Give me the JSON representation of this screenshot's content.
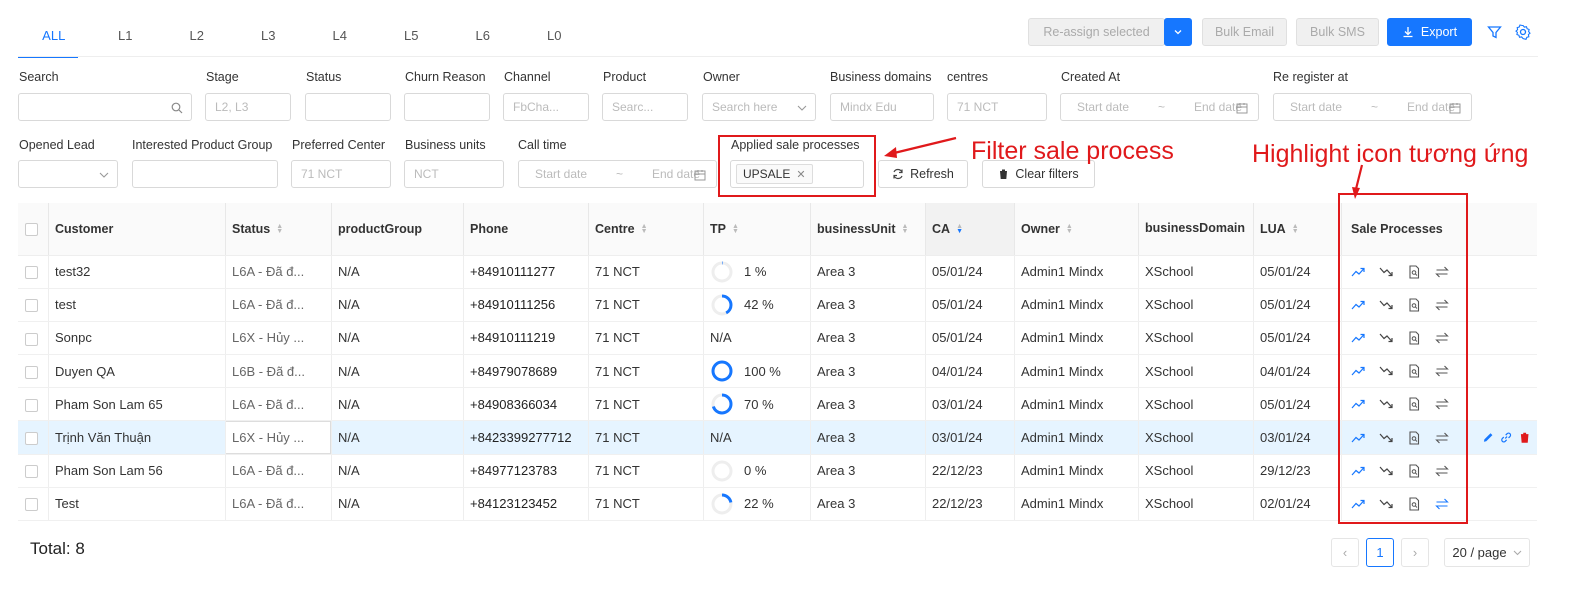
{
  "tabs": [
    "ALL",
    "L1",
    "L2",
    "L3",
    "L4",
    "L5",
    "L6",
    "L0"
  ],
  "toolbar": {
    "reassign": "Re-assign selected",
    "bulk_email": "Bulk Email",
    "bulk_sms": "Bulk SMS",
    "export": "Export"
  },
  "filters": {
    "search": "Search",
    "stage": "Stage",
    "stage_ph": "L2, L3",
    "status": "Status",
    "churn": "Churn Reason",
    "channel": "Channel",
    "channel_ph": "FbCha...",
    "product": "Product",
    "product_ph": "Searc...",
    "owner": "Owner",
    "owner_ph": "Search here",
    "bd": "Business domains",
    "bd_ph": "Mindx Edu",
    "centres": "centres",
    "centres_ph": "71 NCT",
    "created": "Created At",
    "reregister": "Re register at",
    "start": "Start date",
    "end": "End date",
    "opened": "Opened Lead",
    "ipg": "Interested Product Group",
    "pref": "Preferred Center",
    "pref_ph": "71 NCT",
    "bu": "Business units",
    "bu_ph": "NCT",
    "calltime": "Call time",
    "applied": "Applied sale processes",
    "applied_tag": "UPSALE",
    "refresh": "Refresh",
    "clear": "Clear filters"
  },
  "annotations": {
    "filter": "Filter sale process",
    "highlight": "Highlight icon tương ứng"
  },
  "columns": [
    "Customer",
    "Status",
    "productGroup",
    "Phone",
    "Centre",
    "TP",
    "businessUnit",
    "CA",
    "Owner",
    "businessDomain",
    "LUA",
    "Sale Processes"
  ],
  "rows": [
    {
      "customer": "test32",
      "status": "L6A - Đã đ...",
      "pg": "N/A",
      "phone": "+84910111277",
      "centre": "71 NCT",
      "tp": "1 %",
      "tpv": 1,
      "bu": "Area 3",
      "ca": "05/01/24",
      "owner": "Admin1 Mindx",
      "bd": "XSchool",
      "lua": "05/01/24"
    },
    {
      "customer": "test",
      "status": "L6A - Đã đ...",
      "pg": "N/A",
      "phone": "+84910111256",
      "centre": "71 NCT",
      "tp": "42 %",
      "tpv": 42,
      "bu": "Area 3",
      "ca": "05/01/24",
      "owner": "Admin1 Mindx",
      "bd": "XSchool",
      "lua": "05/01/24"
    },
    {
      "customer": "Sonpc",
      "status": "L6X - Hủy ...",
      "pg": "N/A",
      "phone": "+84910111219",
      "centre": "71 NCT",
      "tp": "N/A",
      "tpv": null,
      "bu": "Area 3",
      "ca": "05/01/24",
      "owner": "Admin1 Mindx",
      "bd": "XSchool",
      "lua": "05/01/24"
    },
    {
      "customer": "Duyen QA",
      "status": "L6B - Đã đ...",
      "pg": "N/A",
      "phone": "+84979078689",
      "centre": "71 NCT",
      "tp": "100 %",
      "tpv": 100,
      "bu": "Area 3",
      "ca": "04/01/24",
      "owner": "Admin1 Mindx",
      "bd": "XSchool",
      "lua": "04/01/24"
    },
    {
      "customer": "Pham Son Lam 65",
      "status": "L6A - Đã đ...",
      "pg": "N/A",
      "phone": "+84908366034",
      "centre": "71 NCT",
      "tp": "70 %",
      "tpv": 70,
      "bu": "Area 3",
      "ca": "03/01/24",
      "owner": "Admin1 Mindx",
      "bd": "XSchool",
      "lua": "05/01/24"
    },
    {
      "customer": "Trịnh Văn Thuận",
      "status": "L6X - Hủy ...",
      "pg": "N/A",
      "phone": "+8423399277712",
      "centre": "71 NCT",
      "tp": "N/A",
      "tpv": null,
      "bu": "Area 3",
      "ca": "03/01/24",
      "owner": "Admin1 Mindx",
      "bd": "XSchool",
      "lua": "03/01/24"
    },
    {
      "customer": "Pham Son Lam 56",
      "status": "L6A - Đã đ...",
      "pg": "N/A",
      "phone": "+84977123783",
      "centre": "71 NCT",
      "tp": "0 %",
      "tpv": 0,
      "bu": "Area 3",
      "ca": "22/12/23",
      "owner": "Admin1 Mindx",
      "bd": "XSchool",
      "lua": "29/12/23"
    },
    {
      "customer": "Test",
      "status": "L6A - Đã đ...",
      "pg": "N/A",
      "phone": "+84123123452",
      "centre": "71 NCT",
      "tp": "22 %",
      "tpv": 22,
      "bu": "Area 3",
      "ca": "22/12/23",
      "owner": "Admin1 Mindx",
      "bd": "XSchool",
      "lua": "02/01/24"
    }
  ],
  "highlighted_row": 5,
  "total": "Total: 8",
  "page": "1",
  "page_size": "20 / page",
  "colors": {
    "accent": "#1677ff",
    "annotation": "#e0191b",
    "row_highlight": "#e6f4ff"
  }
}
